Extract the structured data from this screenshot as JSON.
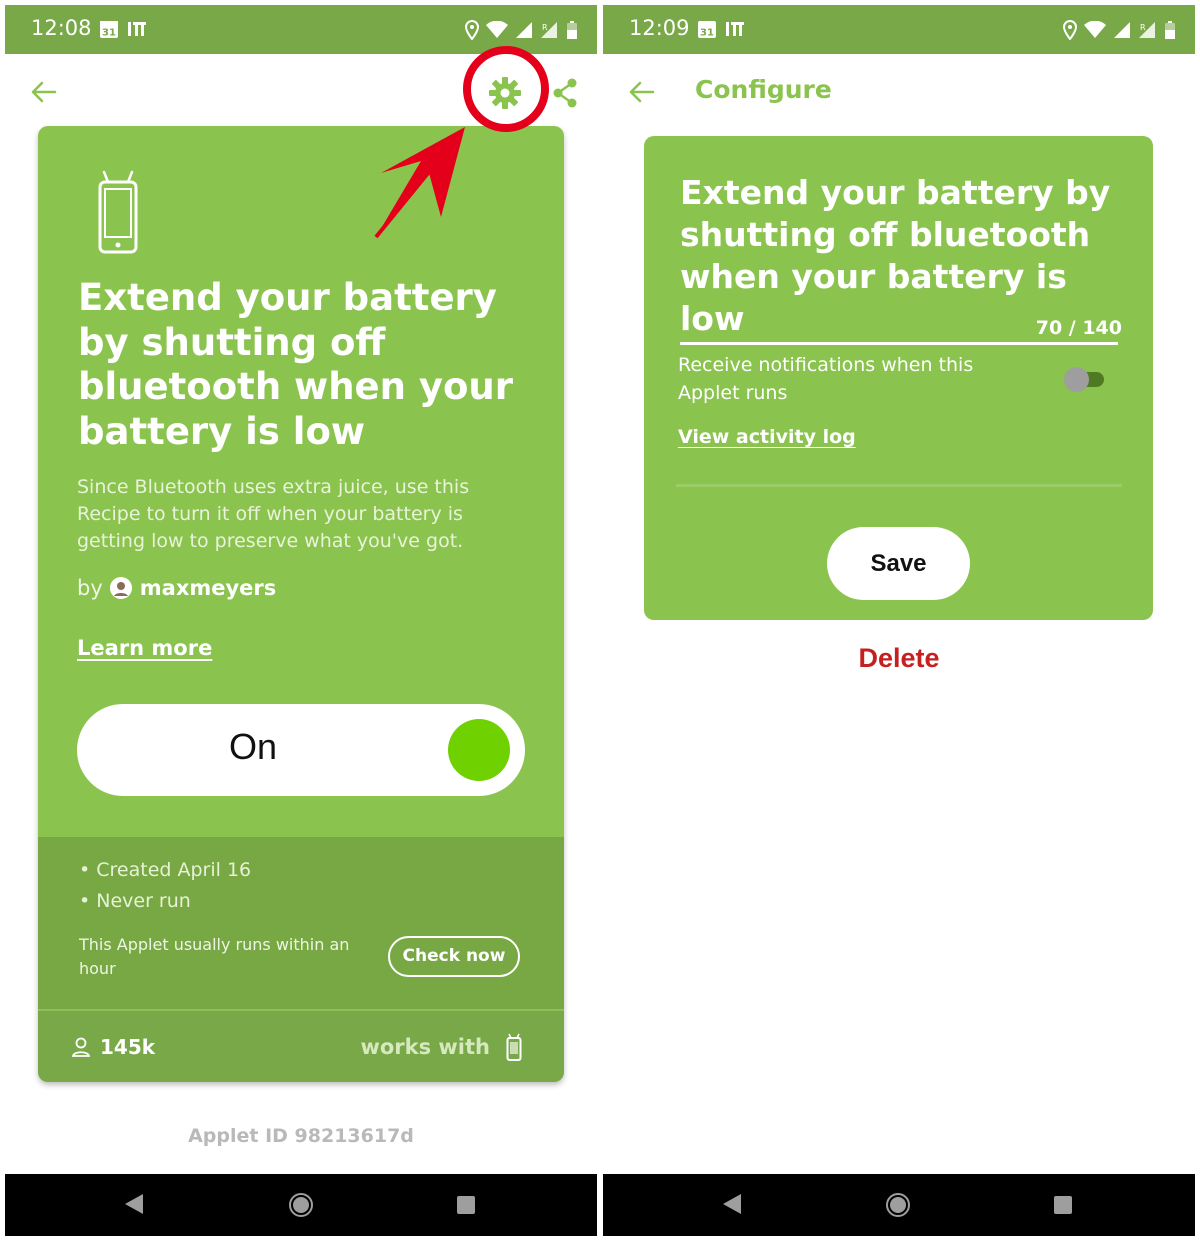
{
  "left": {
    "status": {
      "time": "12:08"
    },
    "applet": {
      "title": "Extend your battery by shutting off bluetooth when your battery is low",
      "description": "Since Bluetooth uses extra juice, use this Recipe to turn it off when your battery is getting low to preserve what you've got.",
      "by_label": "by",
      "author": "maxmeyers",
      "learn_more": "Learn more",
      "toggle_label": "On",
      "created": "• Created April 16",
      "runs": "• Never run",
      "runs_note": "This Applet usually runs within an hour",
      "check_now": "Check now",
      "users": "145k",
      "works_with": "works with"
    },
    "applet_id": "Applet ID 98213617d"
  },
  "right": {
    "status": {
      "time": "12:09"
    },
    "header_title": "Configure",
    "applet_title": "Extend your battery by shutting off bluetooth when your battery is low",
    "char_count": "70 / 140",
    "notification_text": "Receive notifications when this Applet runs",
    "view_activity_log": "View activity log",
    "save": "Save",
    "delete": "Delete"
  },
  "colors": {
    "status_bar": "#79a848",
    "card_green": "#8bc34f",
    "footer_green": "#78a844",
    "toggle_knob_on": "#6fd100",
    "delete_red": "#c51f1f",
    "annotation_red": "#e4001b"
  },
  "icons": {
    "back": "arrow-left-icon",
    "settings": "gear-icon",
    "share": "share-icon",
    "device": "android-phone-icon",
    "users": "user-icon",
    "nav_back": "triangle-back-icon",
    "nav_home": "circle-home-icon",
    "nav_recent": "square-recent-icon"
  }
}
